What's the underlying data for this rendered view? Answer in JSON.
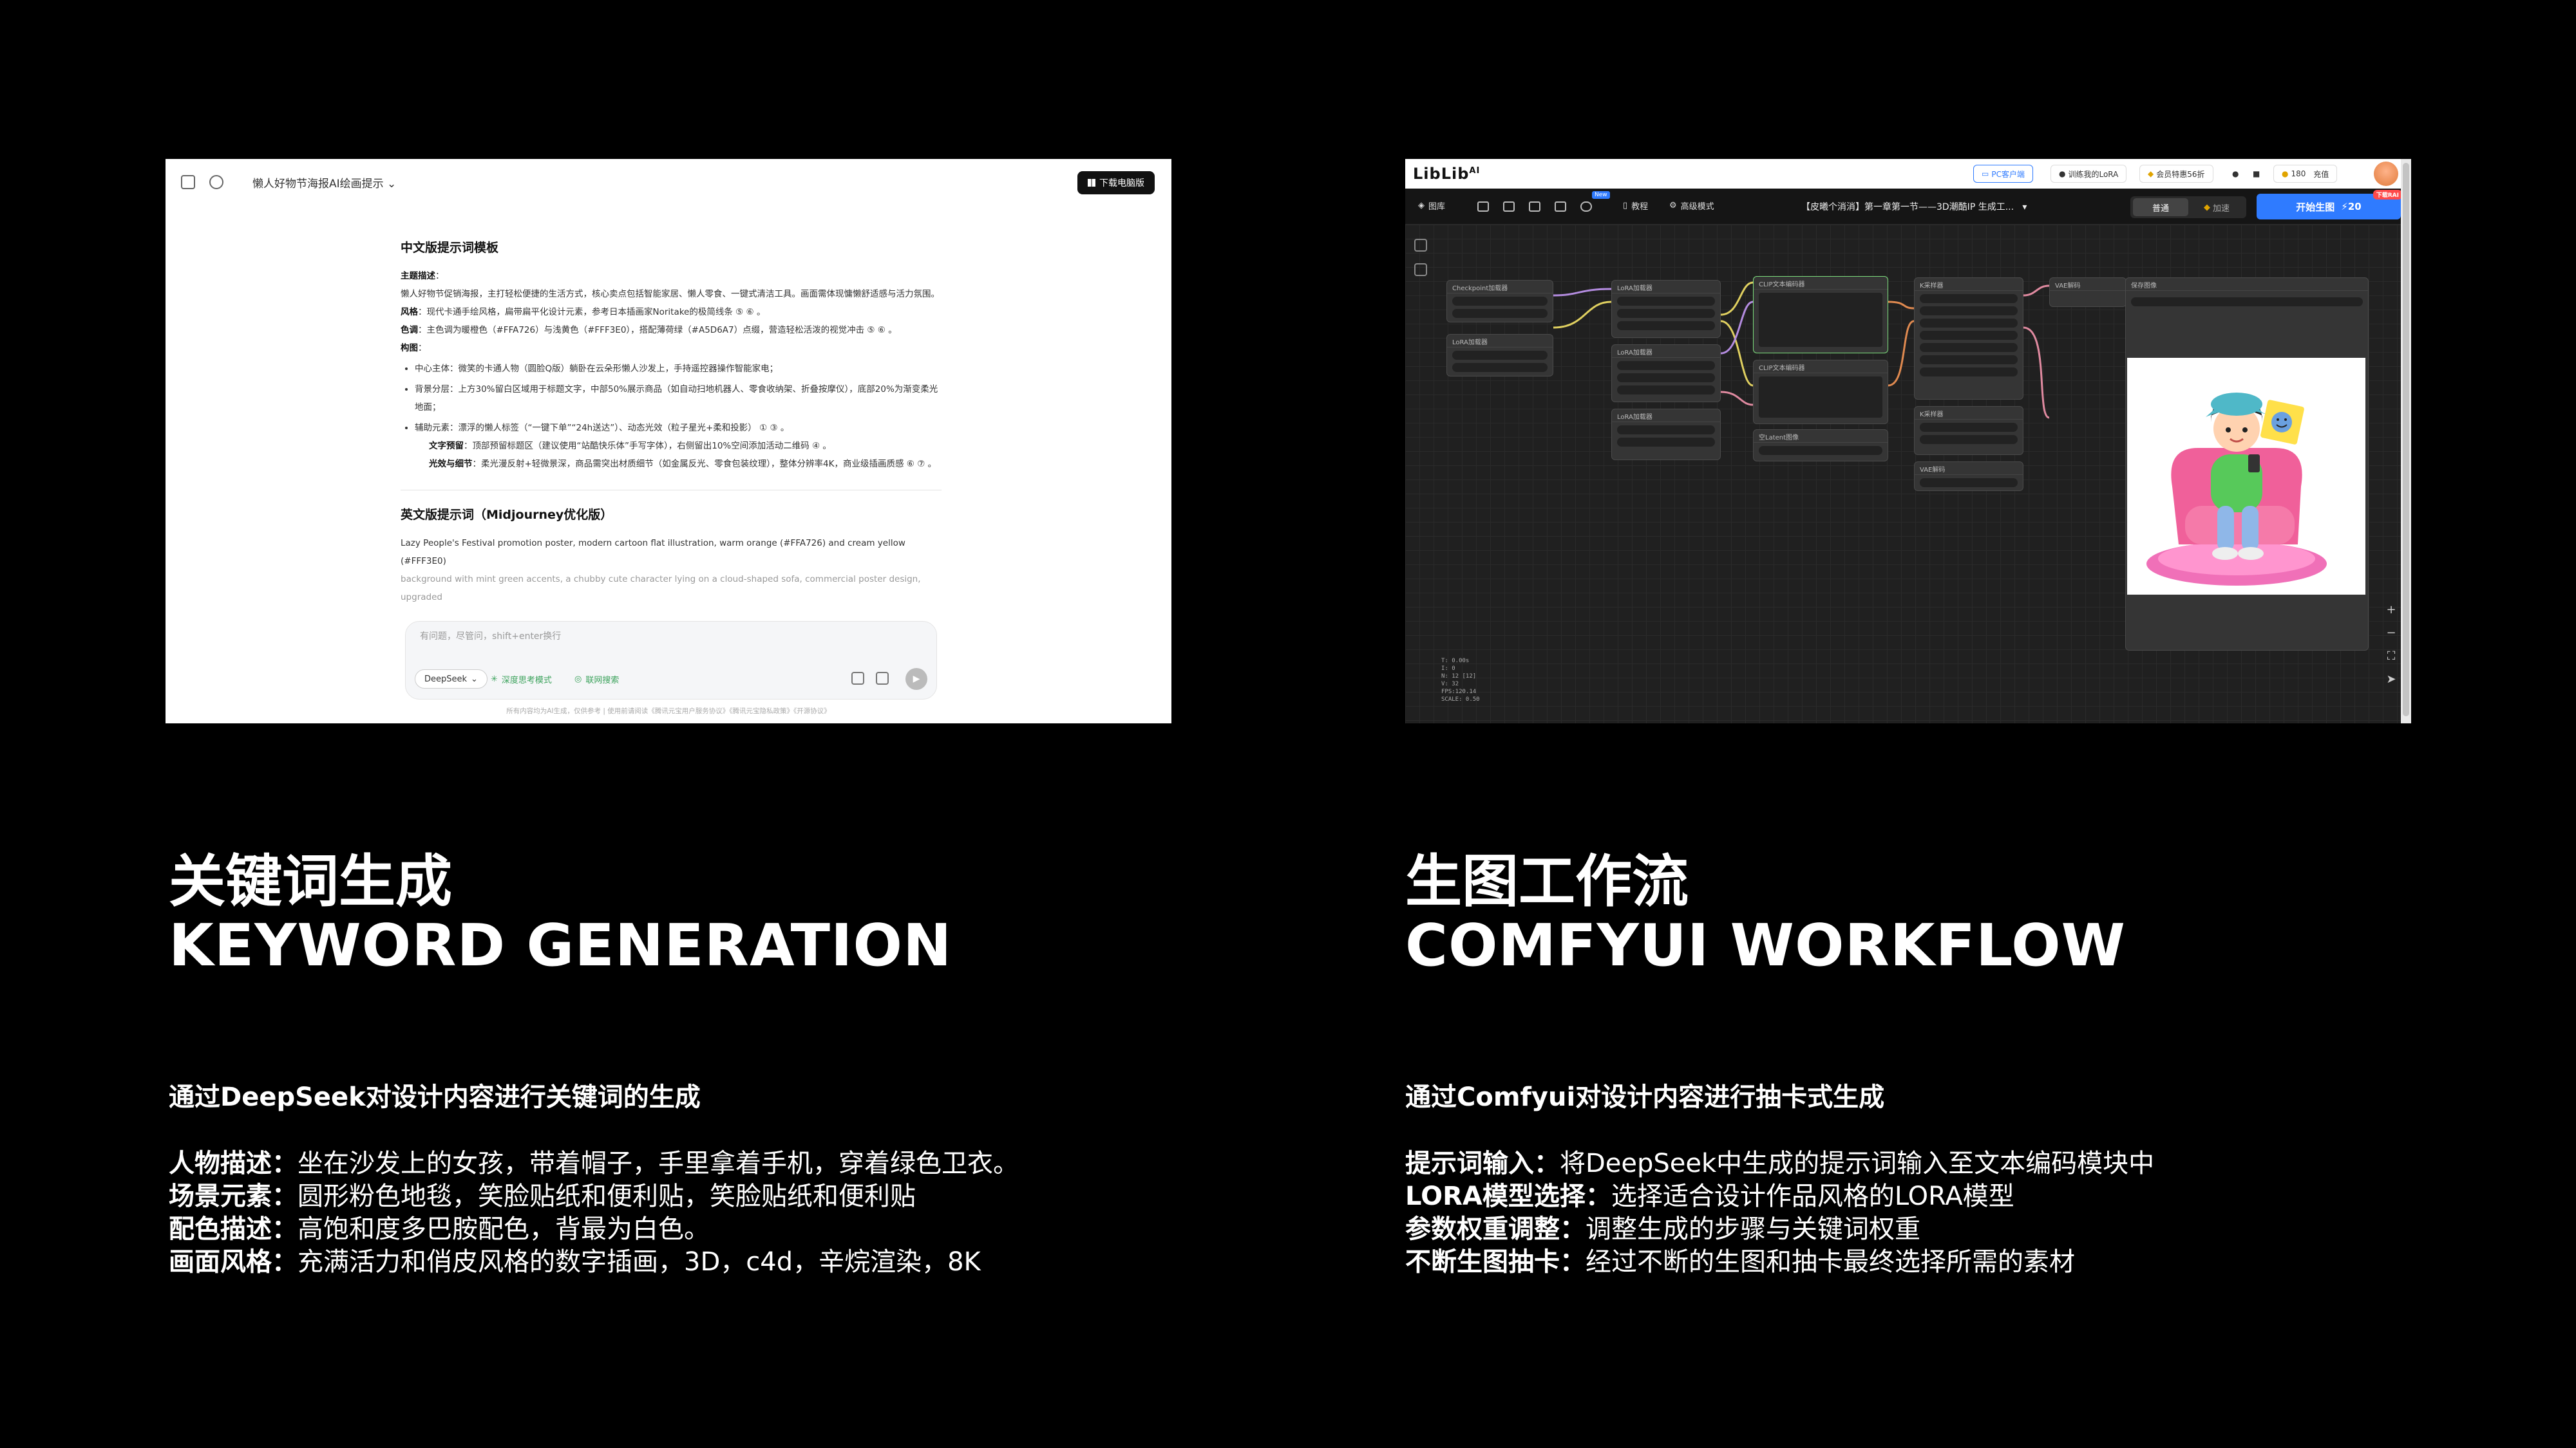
{
  "left_panel": {
    "app_title": "懒人好物节海报AI绘画提示",
    "download_label": "下载电脑版",
    "content": {
      "cn_heading": "中文版提示词模板",
      "theme_label": "主题描述",
      "theme_text": "懒人好物节促销海报，主打轻松便捷的生活方式，核心卖点包括智能家居、懒人零食、一键式清洁工具。画面需体现慵懒舒适感与活力氛围。",
      "style_label": "风格",
      "style_text": "现代卡通手绘风格，扁带扁平化设计元素，参考日本插画家Noritake的极简线条",
      "color_label": "色调",
      "color_text": "主色调为暖橙色（#FFA726）与浅黄色（#FFF3E0），搭配薄荷绿（#A5D6A7）点缀，营造轻松活泼的视觉冲击",
      "composition_label": "构图",
      "bullet1": "中心主体：微笑的卡通人物（圆脸Q版）躺卧在云朵形懒人沙发上，手持遥控器操作智能家电；",
      "bullet2": "背景分层：上方30%留白区域用于标题文字，中部50%展示商品（如自动扫地机器人、零食收纳架、折叠按摩仪），底部20%为渐变柔光地面；",
      "bullet3": "辅助元素：漂浮的懒人标签（“一键下单”“24h送达”）、动态光效（粒子星光+柔和投影）",
      "text_label": "文字预留",
      "text_text": "顶部预留标题区（建议使用“站酷快乐体”手写字体），右侧留出10%空间添加活动二维码",
      "light_label": "光效与细节",
      "light_text": "柔光漫反射+轻微景深，商品需突出材质细节（如金属反光、零食包装纹理），整体分辨率4K，商业级插画质感",
      "en_heading": "英文版提示词（Midjourney优化版）",
      "en_line1": "Lazy People's Festival promotion poster, modern cartoon flat illustration, warm orange (#FFA726) and cream yellow (#FFF3E0)",
      "en_line2": "background with mint green accents, a chubby cute character lying on a cloud-shaped sofa, commercial poster design, upgraded"
    },
    "input_placeholder": "有问题，尽管问，shift+enter换行",
    "model_select": "DeepSeek",
    "chip_deep_think": "深度思考模式",
    "chip_web_search": "联网搜索",
    "footer_note": "所有内容均为AI生成，仅供参考 | 使用前请阅读《腾讯元宝用户服务协议》《腾讯元宝隐私政策》《开源协议》"
  },
  "right_panel": {
    "brand": "LibLib",
    "brand_sup": "AI",
    "topbar": {
      "client": "PC客户端",
      "train_lora": "训练我的LoRA",
      "member": "会员特惠56折",
      "points": "180",
      "recharge": "充值"
    },
    "toolbar": {
      "library": "图库",
      "tutorial": "教程",
      "tutorial_badge": "New",
      "advanced": "高级模式",
      "workflow_title": "【皮曦个消消】第一章第一节——3D潮酷IP 生成工...",
      "mode_normal": "普通",
      "mode_fast": "加速",
      "generate": "开始生图",
      "generate_cost": "20",
      "generate_badge": "下载RAI"
    },
    "nodes": {
      "checkpoint": "Checkpoint加载器",
      "lora_loader": "LoRA加载器",
      "clip_encode": "CLIP文本编码器",
      "ksampler": "K采样器",
      "vae_decode": "VAE解码",
      "save_image": "保存图像",
      "empty_latent": "空Latent图像"
    },
    "stats": [
      "T: 0.00s",
      "I: 0",
      "N: 12 [12]",
      "V: 32",
      "FPS:120.14",
      "SCALE: 0.50"
    ]
  },
  "captions": {
    "left": {
      "cn": "关键词生成",
      "en": "KEYWORD GENERATION",
      "subtitle": "通过DeepSeek对设计内容进行关键词的生成",
      "items": [
        {
          "k": "人物描述：",
          "v": "坐在沙发上的女孩，带着帽子，手里拿着手机，穿着绿色卫衣。"
        },
        {
          "k": "场景元素：",
          "v": "圆形粉色地毯，笑脸贴纸和便利贴，笑脸贴纸和便利贴"
        },
        {
          "k": "配色描述：",
          "v": "高饱和度多巴胺配色，背最为白色。"
        },
        {
          "k": "画面风格：",
          "v": "充满活力和俏皮风格的数字插画，3D，c4d，辛烷渲染，8K"
        }
      ]
    },
    "right": {
      "cn": "生图工作流",
      "en": "COMFYUI WORKFLOW",
      "subtitle": "通过Comfyui对设计内容进行抽卡式生成",
      "items": [
        {
          "k": "提示词输入：",
          "v": "将DeepSeek中生成的提示词输入至文本编码模块中"
        },
        {
          "k": "LORA模型选择：",
          "v": "选择适合设计作品风格的LORA模型"
        },
        {
          "k": "参数权重调整：",
          "v": "调整生成的步骤与关键词权重"
        },
        {
          "k": "不断生图抽卡：",
          "v": "经过不断的生图和抽卡最终选择所需的素材"
        }
      ]
    }
  }
}
